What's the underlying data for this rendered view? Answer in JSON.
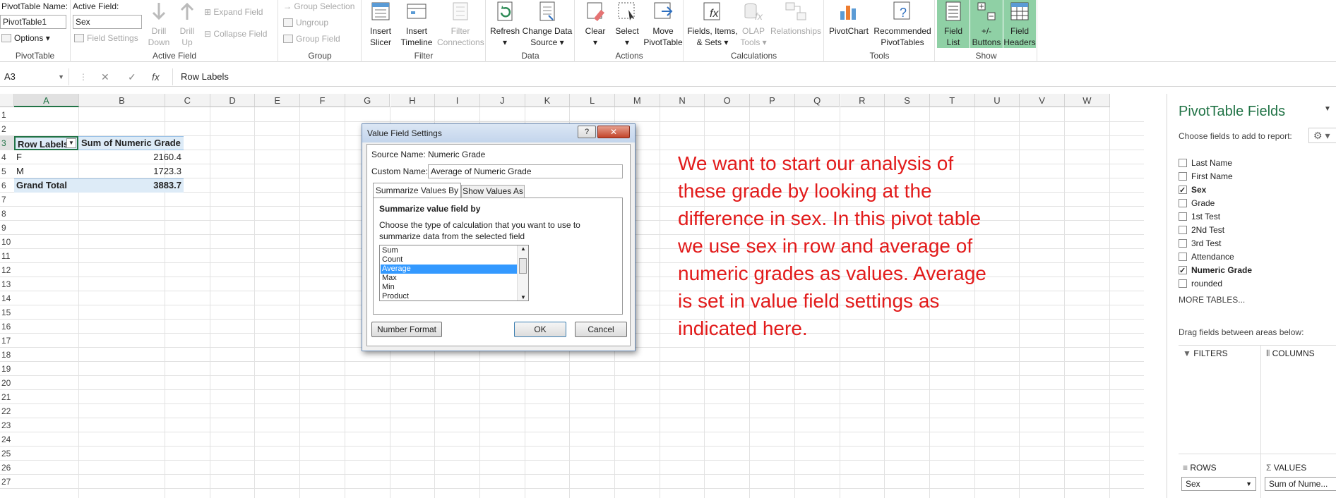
{
  "ribbon": {
    "pivottable": {
      "name_label": "PivotTable Name:",
      "name_value": "PivotTable1",
      "options_label": "Options",
      "group_label": "PivotTable"
    },
    "active_field": {
      "label": "Active Field:",
      "value": "Sex",
      "field_settings": "Field Settings",
      "drill_down_1": "Drill",
      "drill_down_2": "Down",
      "drill_up_1": "Drill",
      "drill_up_2": "Up",
      "expand_field": "Expand Field",
      "collapse_field": "Collapse Field",
      "group_label": "Active Field"
    },
    "group": {
      "group_selection": "Group Selection",
      "ungroup": "Ungroup",
      "group_field": "Group Field",
      "group_label": "Group"
    },
    "filter": {
      "insert_slicer_1": "Insert",
      "insert_slicer_2": "Slicer",
      "insert_timeline_1": "Insert",
      "insert_timeline_2": "Timeline",
      "filter_connections_1": "Filter",
      "filter_connections_2": "Connections",
      "group_label": "Filter"
    },
    "data": {
      "refresh": "Refresh",
      "change_source_1": "Change Data",
      "change_source_2": "Source",
      "group_label": "Data"
    },
    "actions": {
      "clear": "Clear",
      "select": "Select",
      "move_1": "Move",
      "move_2": "PivotTable",
      "group_label": "Actions"
    },
    "calculations": {
      "fields_1": "Fields, Items,",
      "fields_2": "& Sets",
      "olap_1": "OLAP",
      "olap_2": "Tools",
      "relationships": "Relationships",
      "group_label": "Calculations"
    },
    "tools": {
      "pivotchart": "PivotChart",
      "recommended_1": "Recommended",
      "recommended_2": "PivotTables",
      "group_label": "Tools"
    },
    "show": {
      "field_list_1": "Field",
      "field_list_2": "List",
      "buttons_1": "+/-",
      "buttons_2": "Buttons",
      "headers_1": "Field",
      "headers_2": "Headers",
      "group_label": "Show"
    }
  },
  "formula_bar": {
    "name_box": "A3",
    "cancel": "✕",
    "enter": "✓",
    "fx": "fx",
    "content": "Row Labels"
  },
  "grid": {
    "columns": [
      "A",
      "B",
      "C",
      "D",
      "E",
      "F",
      "G",
      "H",
      "I",
      "J",
      "K",
      "L",
      "M",
      "N",
      "O",
      "P",
      "Q",
      "R",
      "S",
      "T",
      "U",
      "V",
      "W"
    ],
    "rows": [
      "1",
      "2",
      "3",
      "4",
      "5",
      "6",
      "7",
      "8",
      "9",
      "10",
      "11",
      "12",
      "13",
      "14",
      "15",
      "16",
      "17",
      "18",
      "19",
      "20",
      "21",
      "22",
      "23",
      "24",
      "25",
      "26",
      "27"
    ],
    "pivot": {
      "header_label": "Row Labels",
      "header_value": "Sum of Numeric Grade",
      "rows": [
        {
          "label": "F",
          "value": "2160.4"
        },
        {
          "label": "M",
          "value": "1723.3"
        }
      ],
      "total_label": "Grand Total",
      "total_value": "3883.7"
    }
  },
  "dialog": {
    "title": "Value Field Settings",
    "help": "?",
    "close": "✕",
    "source_label": "Source Name:",
    "source_value": "Numeric Grade",
    "custom_label": "Custom Name:",
    "custom_value": "Average of Numeric Grade",
    "tab_summarize": "Summarize Values By",
    "tab_show": "Show Values As",
    "section_title": "Summarize value field by",
    "description": "Choose the type of calculation that you want to use to summarize data from the selected field",
    "options": [
      "Sum",
      "Count",
      "Average",
      "Max",
      "Min",
      "Product"
    ],
    "selected_option": "Average",
    "number_format": "Number Format",
    "ok": "OK",
    "cancel": "Cancel"
  },
  "annotation": "We want to start our analysis of these grade by looking at the difference in sex. In this pivot table we use sex in row and average of numeric grades as values. Average is set in value field settings as indicated here.",
  "field_pane": {
    "title": "PivotTable Fields",
    "subtitle": "Choose fields to add to report:",
    "fields": [
      {
        "name": "Last Name",
        "checked": false
      },
      {
        "name": "First Name",
        "checked": false
      },
      {
        "name": "Sex",
        "checked": true
      },
      {
        "name": "Grade",
        "checked": false
      },
      {
        "name": "1st Test",
        "checked": false
      },
      {
        "name": "2Nd Test",
        "checked": false
      },
      {
        "name": "3rd Test",
        "checked": false
      },
      {
        "name": "Attendance",
        "checked": false
      },
      {
        "name": "Numeric Grade",
        "checked": true
      },
      {
        "name": "rounded",
        "checked": false
      }
    ],
    "more_tables": "MORE TABLES...",
    "drag_hint": "Drag fields between areas below:",
    "filters": "FILTERS",
    "columns": "COLUMNS",
    "rows": "ROWS",
    "values": "VALUES",
    "rows_item": "Sex",
    "values_item": "Sum of Nume..."
  },
  "colors": {
    "accent": "#217346",
    "annotation": "#e21b1b",
    "selection": "#3399ff",
    "show_group_bg": "#8fd0a5"
  }
}
